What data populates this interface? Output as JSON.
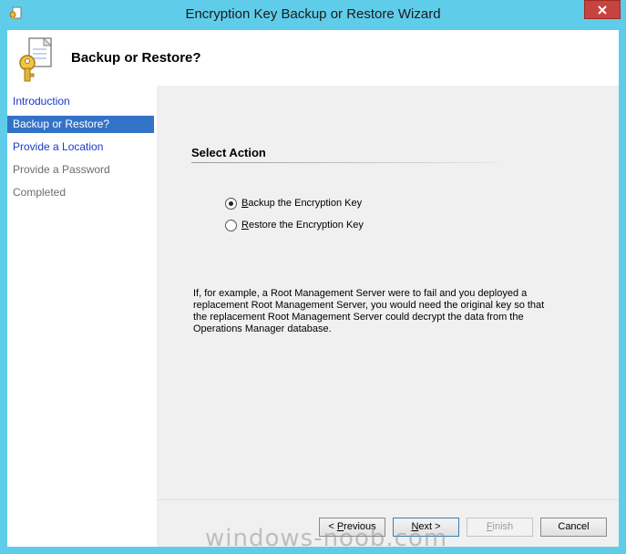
{
  "window": {
    "title": "Encryption Key Backup or Restore Wizard",
    "icons": {
      "app": "key-document-icon",
      "close": "close-icon"
    }
  },
  "header": {
    "title": "Backup or Restore?",
    "icon": "key-document-icon"
  },
  "nav": {
    "items": [
      {
        "label": "Introduction",
        "state": "link"
      },
      {
        "label": "Backup or Restore?",
        "state": "selected"
      },
      {
        "label": "Provide a Location",
        "state": "link"
      },
      {
        "label": "Provide a Password",
        "state": "disabled"
      },
      {
        "label": "Completed",
        "state": "disabled"
      }
    ]
  },
  "main": {
    "section_title": "Select Action",
    "options": [
      {
        "accel": "B",
        "rest": "ackup the Encryption Key",
        "selected": true
      },
      {
        "accel": "R",
        "rest": "estore the Encryption Key",
        "selected": false
      }
    ],
    "description": "If, for example, a Root Management Server were to fail and you deployed a replacement Root Management Server, you would need the original key so that the replacement Root Management Server could decrypt the data from the Operations Manager database."
  },
  "buttons": {
    "previous": {
      "prefix": "< ",
      "accel": "P",
      "rest": "revious"
    },
    "next": {
      "accel": "N",
      "rest": "ext >"
    },
    "finish": {
      "accel": "F",
      "rest": "inish",
      "enabled": false
    },
    "cancel": {
      "label": "Cancel"
    }
  },
  "watermark": "windows-noob.com",
  "colors": {
    "titlebar": "#5fcdea",
    "selected": "#3373c7",
    "link": "#1a3bc4",
    "close": "#c7433f"
  }
}
